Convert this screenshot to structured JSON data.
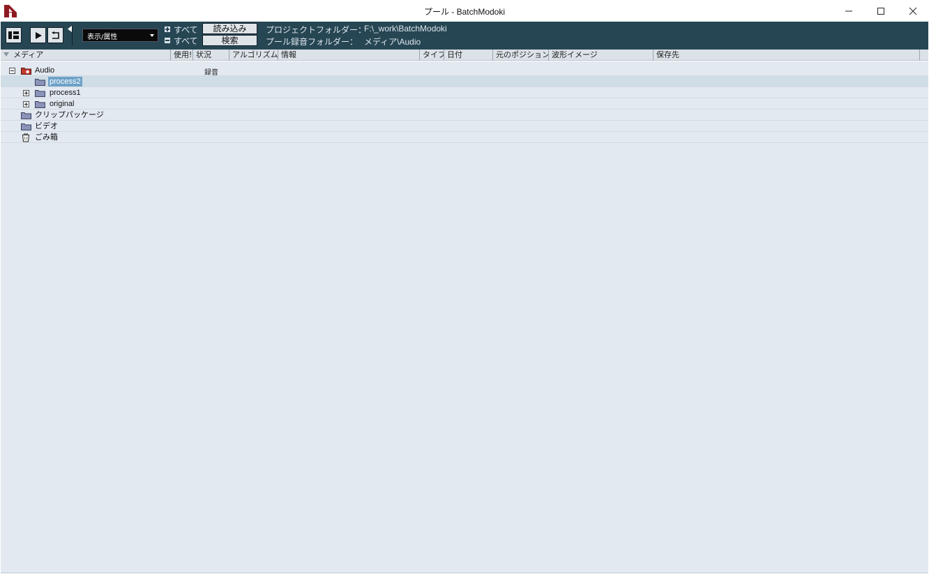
{
  "window": {
    "title": "プール - BatchModoki",
    "minimize_icon": "minimize-icon",
    "maximize_icon": "maximize-icon",
    "close_icon": "close-icon"
  },
  "toolbar": {
    "view_select_value": "表示/属性",
    "expand_all_label": "すべて",
    "collapse_all_label": "すべて",
    "import_label": "読み込み",
    "search_label": "検索",
    "project_folder_label": "プロジェクトフォルダー：",
    "project_folder_value": "F:\\_work\\BatchModoki",
    "record_folder_label": "プール録音フォルダー：",
    "record_folder_value": "メディア\\Audio"
  },
  "columns": [
    "メディア",
    "使用!",
    "状況",
    "アルゴリズム",
    "情報",
    "タイプ",
    "日付",
    "元のポジション",
    "波形イメージ",
    "保存先"
  ],
  "tree": [
    {
      "label": "Audio",
      "status": "録音",
      "expander": "minus",
      "icon": "audio-folder-icon"
    },
    {
      "label": "process2",
      "status": "",
      "expander": "",
      "icon": "folder-icon",
      "selected": true
    },
    {
      "label": "process1",
      "status": "",
      "expander": "plus",
      "icon": "folder-icon"
    },
    {
      "label": "original",
      "status": "",
      "expander": "plus",
      "icon": "folder-icon"
    },
    {
      "label": "クリップパッケージ",
      "status": "",
      "expander": "",
      "icon": "folder-icon"
    },
    {
      "label": "ビデオ",
      "status": "",
      "expander": "",
      "icon": "folder-icon"
    },
    {
      "label": "ごみ箱",
      "status": "",
      "expander": "",
      "icon": "trash-icon"
    }
  ]
}
